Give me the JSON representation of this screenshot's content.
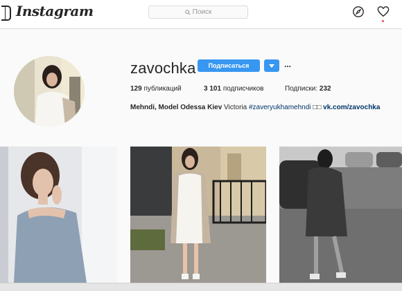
{
  "header": {
    "logo_text": "Instagram",
    "search_placeholder": "Поиск",
    "icons": [
      "camera-logo-icon",
      "search-icon",
      "explore-compass-icon",
      "heart-icon"
    ]
  },
  "profile": {
    "username": "zavochka",
    "follow_label": "Подписаться",
    "more_label": "...",
    "stats": {
      "posts_count": "129",
      "posts_label": "публикаций",
      "followers_count": "3 101",
      "followers_label": "подписчиков",
      "following_label": "Подписки:",
      "following_count": "232"
    },
    "bio": {
      "name": "Mehndi, Model Odessa Kiev",
      "text": "Victoria",
      "hashtag": "#zaveryukhamehndi",
      "emoji": "□□",
      "link": "vk.com/zavochka"
    }
  },
  "colors": {
    "accent": "#3897f0",
    "notification": "#ed4956",
    "link": "#003569"
  },
  "photos": [
    {
      "name": "post-photo-1",
      "description": "woman in blue off-shoulder sweater"
    },
    {
      "name": "post-photo-2",
      "description": "woman in white dress and cardigan on street"
    },
    {
      "name": "post-photo-3",
      "description": "black-and-white photo of woman walking"
    }
  ]
}
